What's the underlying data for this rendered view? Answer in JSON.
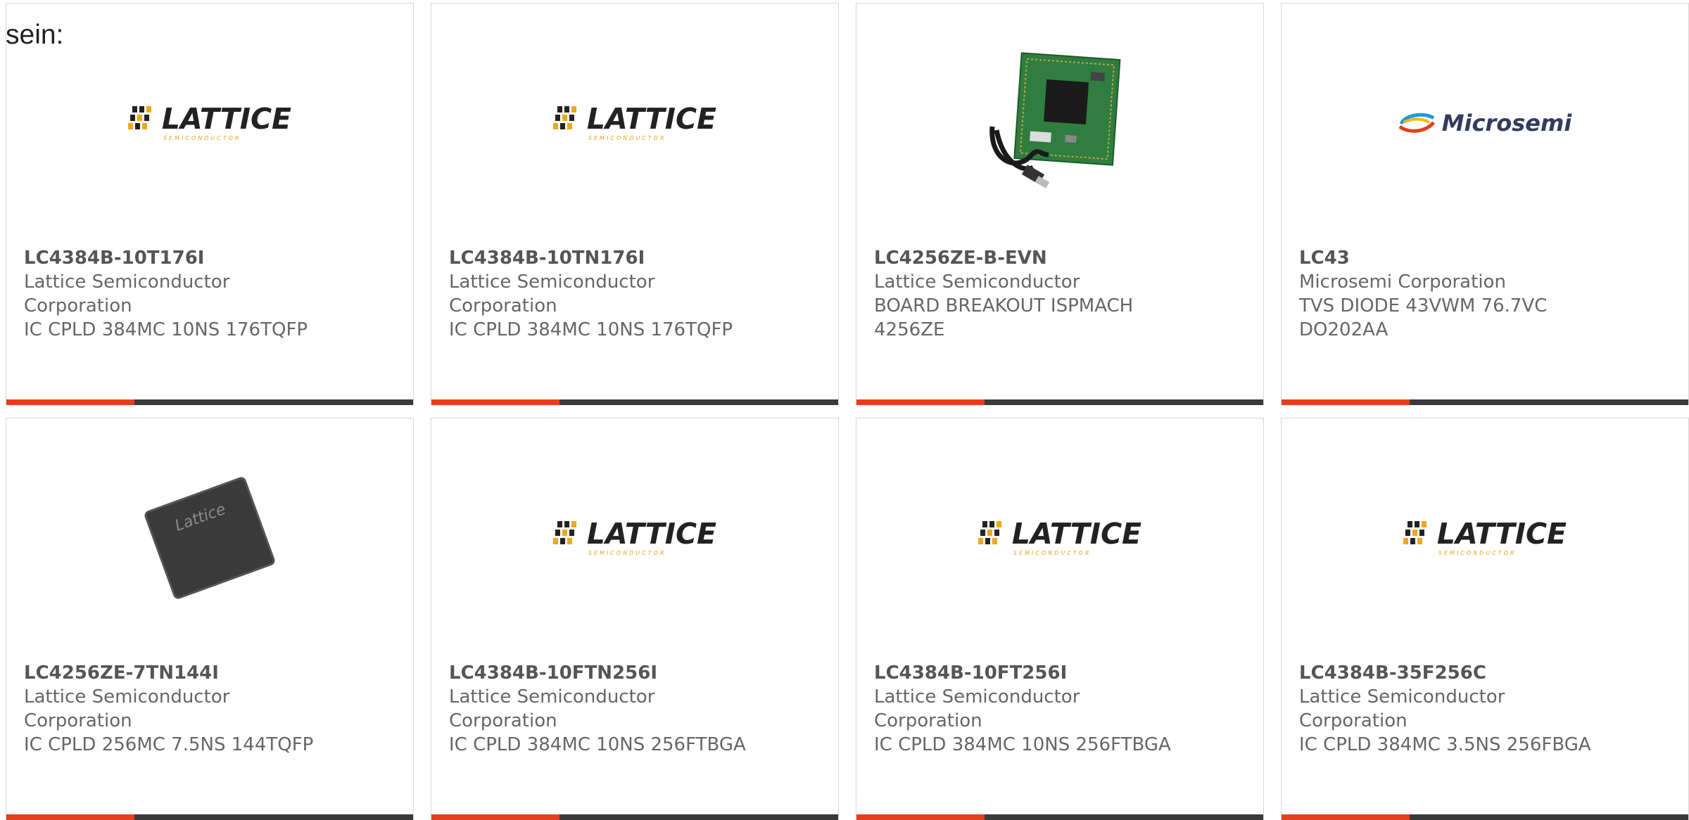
{
  "intro_text": "sein:",
  "colors": {
    "accent": "#e2401c",
    "bar": "#3a3a3a",
    "text": "#666666",
    "border": "#d8d8d8"
  },
  "products": [
    {
      "part_number": "LC4384B-10T176I",
      "manufacturer_line1": "Lattice Semiconductor",
      "manufacturer_line2": "Corporation",
      "description_line1": "IC CPLD 384MC 10NS 176TQFP",
      "description_line2": "",
      "image": "lattice-logo",
      "logo_text": "LATTICE",
      "logo_sub": "SEMICONDUCTOR"
    },
    {
      "part_number": "LC4384B-10TN176I",
      "manufacturer_line1": "Lattice Semiconductor",
      "manufacturer_line2": "Corporation",
      "description_line1": "IC CPLD 384MC 10NS 176TQFP",
      "description_line2": "",
      "image": "lattice-logo",
      "logo_text": "LATTICE",
      "logo_sub": "SEMICONDUCTOR"
    },
    {
      "part_number": "LC4256ZE-B-EVN",
      "manufacturer_line1": "Lattice Semiconductor",
      "manufacturer_line2": "",
      "description_line1": "BOARD BREAKOUT ISPMACH",
      "description_line2": "4256ZE",
      "image": "pcb-board-photo"
    },
    {
      "part_number": "LC43",
      "manufacturer_line1": "Microsemi Corporation",
      "manufacturer_line2": "",
      "description_line1": "TVS DIODE 43VWM 76.7VC",
      "description_line2": "DO202AA",
      "image": "microsemi-logo",
      "logo_text": "Microsemi"
    },
    {
      "part_number": "LC4256ZE-7TN144I",
      "manufacturer_line1": "Lattice Semiconductor",
      "manufacturer_line2": "Corporation",
      "description_line1": "IC CPLD 256MC 7.5NS 144TQFP",
      "description_line2": "",
      "image": "chip-photo",
      "logo_text": "Lattice"
    },
    {
      "part_number": "LC4384B-10FTN256I",
      "manufacturer_line1": "Lattice Semiconductor",
      "manufacturer_line2": "Corporation",
      "description_line1": "IC CPLD 384MC 10NS 256FTBGA",
      "description_line2": "",
      "image": "lattice-logo",
      "logo_text": "LATTICE",
      "logo_sub": "SEMICONDUCTOR"
    },
    {
      "part_number": "LC4384B-10FT256I",
      "manufacturer_line1": "Lattice Semiconductor",
      "manufacturer_line2": "Corporation",
      "description_line1": "IC CPLD 384MC 10NS 256FTBGA",
      "description_line2": "",
      "image": "lattice-logo",
      "logo_text": "LATTICE",
      "logo_sub": "SEMICONDUCTOR"
    },
    {
      "part_number": "LC4384B-35F256C",
      "manufacturer_line1": "Lattice Semiconductor",
      "manufacturer_line2": "Corporation",
      "description_line1": "IC CPLD 384MC 3.5NS 256FBGA",
      "description_line2": "",
      "image": "lattice-logo",
      "logo_text": "LATTICE",
      "logo_sub": "SEMICONDUCTOR"
    }
  ]
}
